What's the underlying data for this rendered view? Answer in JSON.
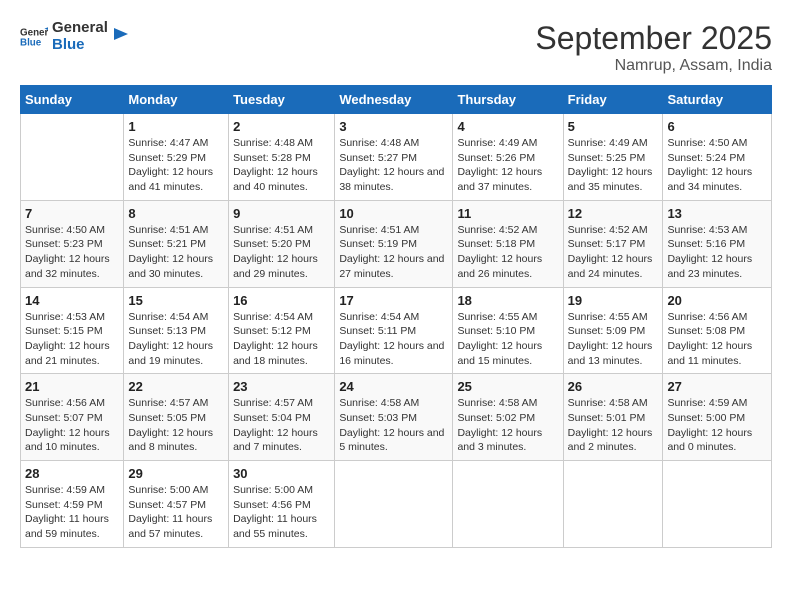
{
  "logo": {
    "text_general": "General",
    "text_blue": "Blue"
  },
  "title": "September 2025",
  "subtitle": "Namrup, Assam, India",
  "days_of_week": [
    "Sunday",
    "Monday",
    "Tuesday",
    "Wednesday",
    "Thursday",
    "Friday",
    "Saturday"
  ],
  "weeks": [
    [
      {
        "day": "",
        "sunrise": "",
        "sunset": "",
        "daylight": ""
      },
      {
        "day": "1",
        "sunrise": "Sunrise: 4:47 AM",
        "sunset": "Sunset: 5:29 PM",
        "daylight": "Daylight: 12 hours and 41 minutes."
      },
      {
        "day": "2",
        "sunrise": "Sunrise: 4:48 AM",
        "sunset": "Sunset: 5:28 PM",
        "daylight": "Daylight: 12 hours and 40 minutes."
      },
      {
        "day": "3",
        "sunrise": "Sunrise: 4:48 AM",
        "sunset": "Sunset: 5:27 PM",
        "daylight": "Daylight: 12 hours and 38 minutes."
      },
      {
        "day": "4",
        "sunrise": "Sunrise: 4:49 AM",
        "sunset": "Sunset: 5:26 PM",
        "daylight": "Daylight: 12 hours and 37 minutes."
      },
      {
        "day": "5",
        "sunrise": "Sunrise: 4:49 AM",
        "sunset": "Sunset: 5:25 PM",
        "daylight": "Daylight: 12 hours and 35 minutes."
      },
      {
        "day": "6",
        "sunrise": "Sunrise: 4:50 AM",
        "sunset": "Sunset: 5:24 PM",
        "daylight": "Daylight: 12 hours and 34 minutes."
      }
    ],
    [
      {
        "day": "7",
        "sunrise": "Sunrise: 4:50 AM",
        "sunset": "Sunset: 5:23 PM",
        "daylight": "Daylight: 12 hours and 32 minutes."
      },
      {
        "day": "8",
        "sunrise": "Sunrise: 4:51 AM",
        "sunset": "Sunset: 5:21 PM",
        "daylight": "Daylight: 12 hours and 30 minutes."
      },
      {
        "day": "9",
        "sunrise": "Sunrise: 4:51 AM",
        "sunset": "Sunset: 5:20 PM",
        "daylight": "Daylight: 12 hours and 29 minutes."
      },
      {
        "day": "10",
        "sunrise": "Sunrise: 4:51 AM",
        "sunset": "Sunset: 5:19 PM",
        "daylight": "Daylight: 12 hours and 27 minutes."
      },
      {
        "day": "11",
        "sunrise": "Sunrise: 4:52 AM",
        "sunset": "Sunset: 5:18 PM",
        "daylight": "Daylight: 12 hours and 26 minutes."
      },
      {
        "day": "12",
        "sunrise": "Sunrise: 4:52 AM",
        "sunset": "Sunset: 5:17 PM",
        "daylight": "Daylight: 12 hours and 24 minutes."
      },
      {
        "day": "13",
        "sunrise": "Sunrise: 4:53 AM",
        "sunset": "Sunset: 5:16 PM",
        "daylight": "Daylight: 12 hours and 23 minutes."
      }
    ],
    [
      {
        "day": "14",
        "sunrise": "Sunrise: 4:53 AM",
        "sunset": "Sunset: 5:15 PM",
        "daylight": "Daylight: 12 hours and 21 minutes."
      },
      {
        "day": "15",
        "sunrise": "Sunrise: 4:54 AM",
        "sunset": "Sunset: 5:13 PM",
        "daylight": "Daylight: 12 hours and 19 minutes."
      },
      {
        "day": "16",
        "sunrise": "Sunrise: 4:54 AM",
        "sunset": "Sunset: 5:12 PM",
        "daylight": "Daylight: 12 hours and 18 minutes."
      },
      {
        "day": "17",
        "sunrise": "Sunrise: 4:54 AM",
        "sunset": "Sunset: 5:11 PM",
        "daylight": "Daylight: 12 hours and 16 minutes."
      },
      {
        "day": "18",
        "sunrise": "Sunrise: 4:55 AM",
        "sunset": "Sunset: 5:10 PM",
        "daylight": "Daylight: 12 hours and 15 minutes."
      },
      {
        "day": "19",
        "sunrise": "Sunrise: 4:55 AM",
        "sunset": "Sunset: 5:09 PM",
        "daylight": "Daylight: 12 hours and 13 minutes."
      },
      {
        "day": "20",
        "sunrise": "Sunrise: 4:56 AM",
        "sunset": "Sunset: 5:08 PM",
        "daylight": "Daylight: 12 hours and 11 minutes."
      }
    ],
    [
      {
        "day": "21",
        "sunrise": "Sunrise: 4:56 AM",
        "sunset": "Sunset: 5:07 PM",
        "daylight": "Daylight: 12 hours and 10 minutes."
      },
      {
        "day": "22",
        "sunrise": "Sunrise: 4:57 AM",
        "sunset": "Sunset: 5:05 PM",
        "daylight": "Daylight: 12 hours and 8 minutes."
      },
      {
        "day": "23",
        "sunrise": "Sunrise: 4:57 AM",
        "sunset": "Sunset: 5:04 PM",
        "daylight": "Daylight: 12 hours and 7 minutes."
      },
      {
        "day": "24",
        "sunrise": "Sunrise: 4:58 AM",
        "sunset": "Sunset: 5:03 PM",
        "daylight": "Daylight: 12 hours and 5 minutes."
      },
      {
        "day": "25",
        "sunrise": "Sunrise: 4:58 AM",
        "sunset": "Sunset: 5:02 PM",
        "daylight": "Daylight: 12 hours and 3 minutes."
      },
      {
        "day": "26",
        "sunrise": "Sunrise: 4:58 AM",
        "sunset": "Sunset: 5:01 PM",
        "daylight": "Daylight: 12 hours and 2 minutes."
      },
      {
        "day": "27",
        "sunrise": "Sunrise: 4:59 AM",
        "sunset": "Sunset: 5:00 PM",
        "daylight": "Daylight: 12 hours and 0 minutes."
      }
    ],
    [
      {
        "day": "28",
        "sunrise": "Sunrise: 4:59 AM",
        "sunset": "Sunset: 4:59 PM",
        "daylight": "Daylight: 11 hours and 59 minutes."
      },
      {
        "day": "29",
        "sunrise": "Sunrise: 5:00 AM",
        "sunset": "Sunset: 4:57 PM",
        "daylight": "Daylight: 11 hours and 57 minutes."
      },
      {
        "day": "30",
        "sunrise": "Sunrise: 5:00 AM",
        "sunset": "Sunset: 4:56 PM",
        "daylight": "Daylight: 11 hours and 55 minutes."
      },
      {
        "day": "",
        "sunrise": "",
        "sunset": "",
        "daylight": ""
      },
      {
        "day": "",
        "sunrise": "",
        "sunset": "",
        "daylight": ""
      },
      {
        "day": "",
        "sunrise": "",
        "sunset": "",
        "daylight": ""
      },
      {
        "day": "",
        "sunrise": "",
        "sunset": "",
        "daylight": ""
      }
    ]
  ]
}
